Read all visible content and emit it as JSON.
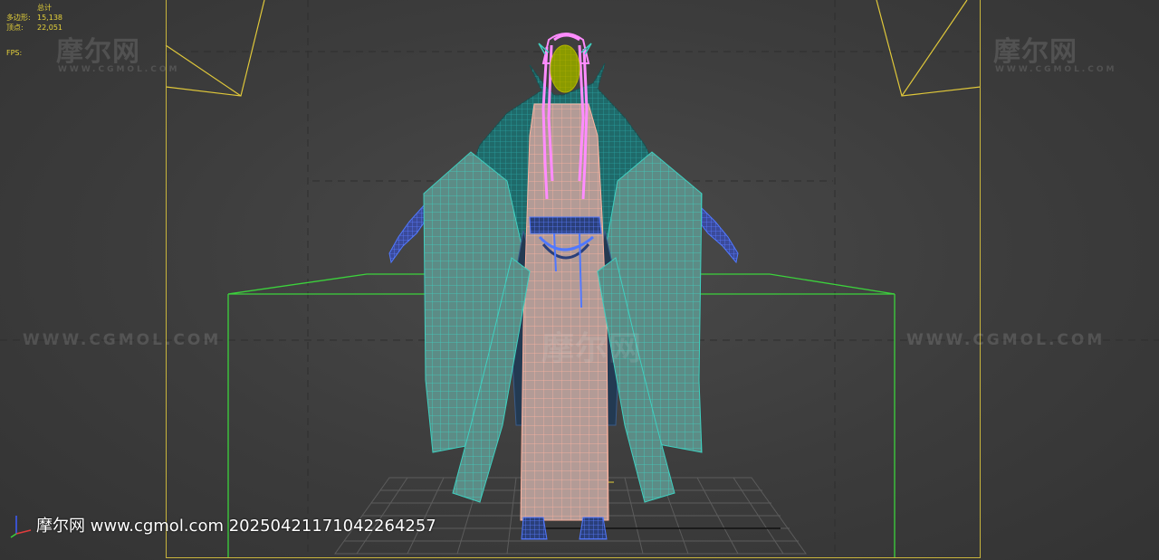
{
  "stats": {
    "header": "总计",
    "polygons_label": "多边形:",
    "polygons_value": "15,138",
    "vertices_label": "顶点:",
    "vertices_value": "22,051",
    "fps_label": "FPS:"
  },
  "watermarks": {
    "logo": "摩尔网",
    "logo_sub": "WWW.CGMOL.COM",
    "url": "WWW.CGMOL.COM",
    "center_logo": "摩尔网"
  },
  "caption": "摩尔网 www.cgmol.com 20250421171042264257",
  "colors": {
    "viewport_bg": "#444444",
    "frame": "#c8b43c",
    "stats_text": "#e6d23a",
    "bbox": "#3cd23c",
    "robe_wire": "#3fd0c0",
    "body_wire": "#ffb4a0",
    "hair_wire": "#ff8cff",
    "hands_wire": "#5078ff"
  },
  "icons": {
    "axis": "axis-gizmo-icon",
    "camera": "camera-icon"
  }
}
